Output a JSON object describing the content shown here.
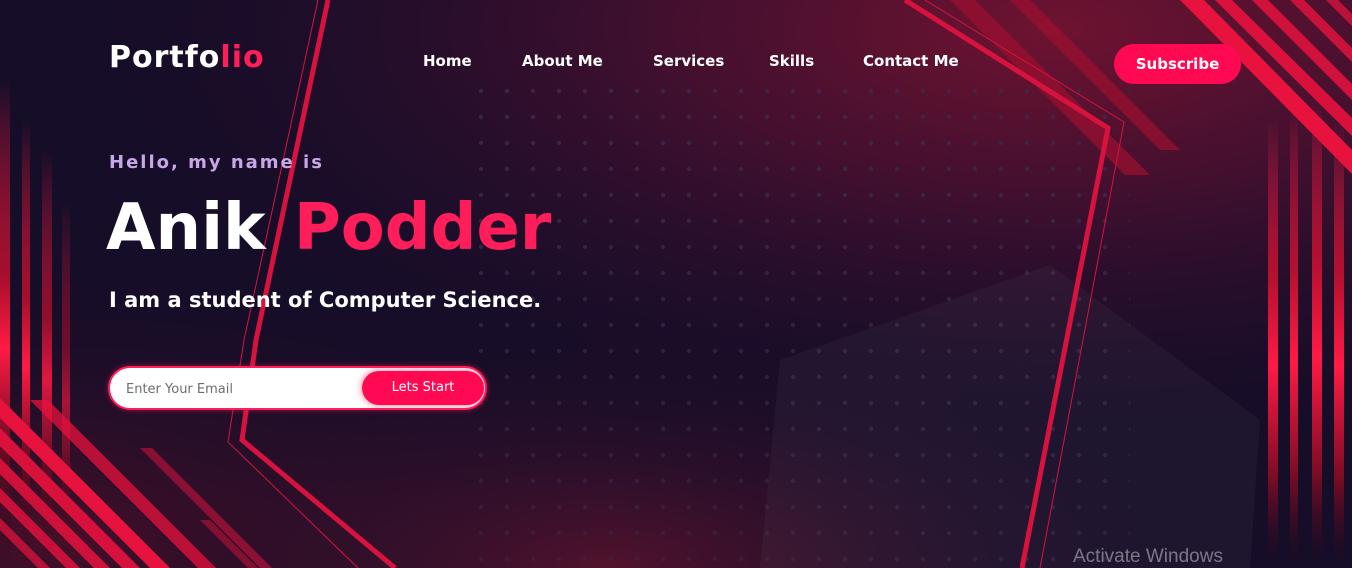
{
  "logo": {
    "text": "Portfo",
    "accent": "lio"
  },
  "nav": {
    "items": [
      {
        "label": "Home"
      },
      {
        "label": "About Me"
      },
      {
        "label": "Services"
      },
      {
        "label": "Skills"
      },
      {
        "label": "Contact Me"
      }
    ],
    "subscribe_label": "Subscribe"
  },
  "hero": {
    "greeting": "Hello, my name is",
    "first_name": "Anik",
    "last_name": "Podder",
    "tagline": "I am a student of Computer Science."
  },
  "email_form": {
    "placeholder": "Enter Your Email",
    "value": "",
    "button_label": "Lets Start"
  },
  "watermark": "Activate Windows",
  "colors": {
    "accent": "#ff1e5a",
    "button": "#ff0a52",
    "background": "#160d28",
    "greeting": "#c9a6e6"
  }
}
